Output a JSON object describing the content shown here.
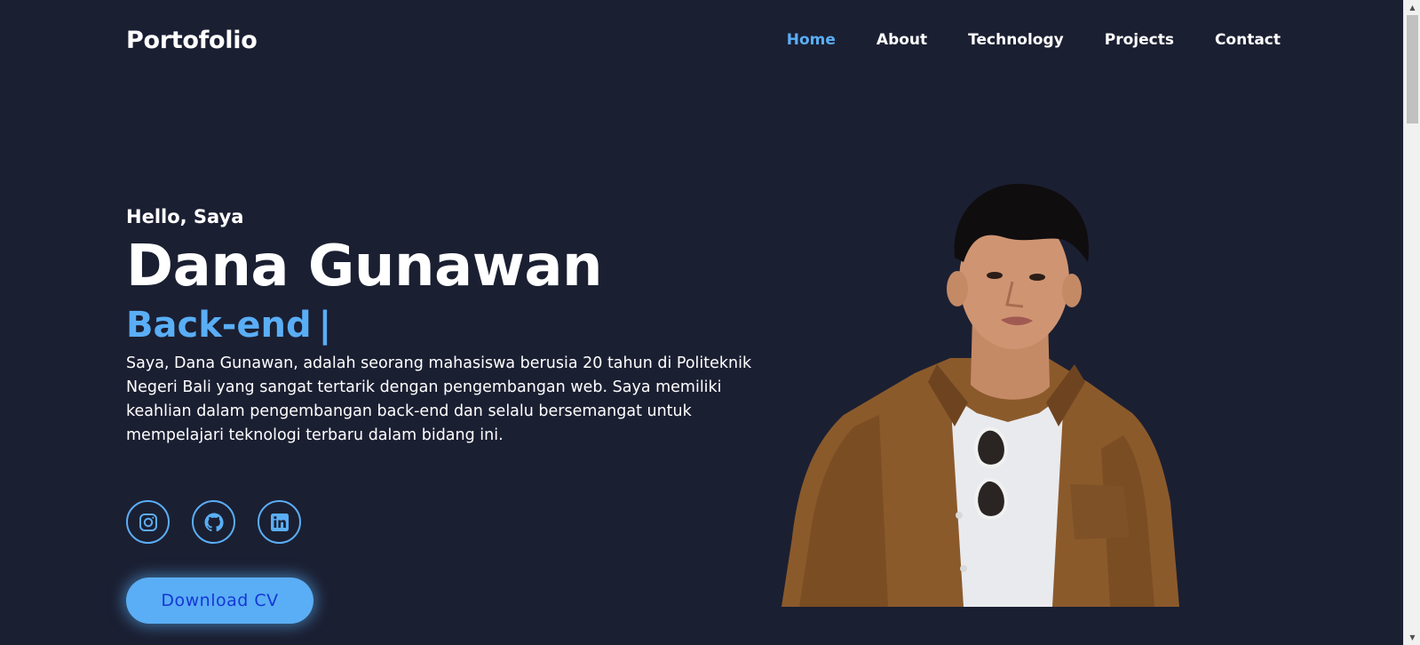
{
  "navbar": {
    "brand": "Portofolio",
    "links": [
      {
        "label": "Home",
        "active": true
      },
      {
        "label": "About",
        "active": false
      },
      {
        "label": "Technology",
        "active": false
      },
      {
        "label": "Projects",
        "active": false
      },
      {
        "label": "Contact",
        "active": false
      }
    ]
  },
  "hero": {
    "greeting": "Hello, Saya",
    "name": "Dana Gunawan",
    "role": "Back-end",
    "role_caret": "|",
    "bio": "Saya, Dana Gunawan, adalah seorang mahasiswa berusia 20 tahun di Politeknik Negeri Bali yang sangat tertarik dengan pengembangan web. Saya memiliki keahlian dalam pengembangan back-end dan selalu bersemangat untuk mempelajari teknologi terbaru dalam bidang ini.",
    "cv_button": "Download CV"
  },
  "socials": [
    {
      "icon": "instagram-icon"
    },
    {
      "icon": "github-icon"
    },
    {
      "icon": "linkedin-icon"
    }
  ],
  "colors": {
    "background": "#1b1f32",
    "accent": "#5aaef5",
    "button_text": "#1437d6",
    "text": "#ffffff"
  }
}
